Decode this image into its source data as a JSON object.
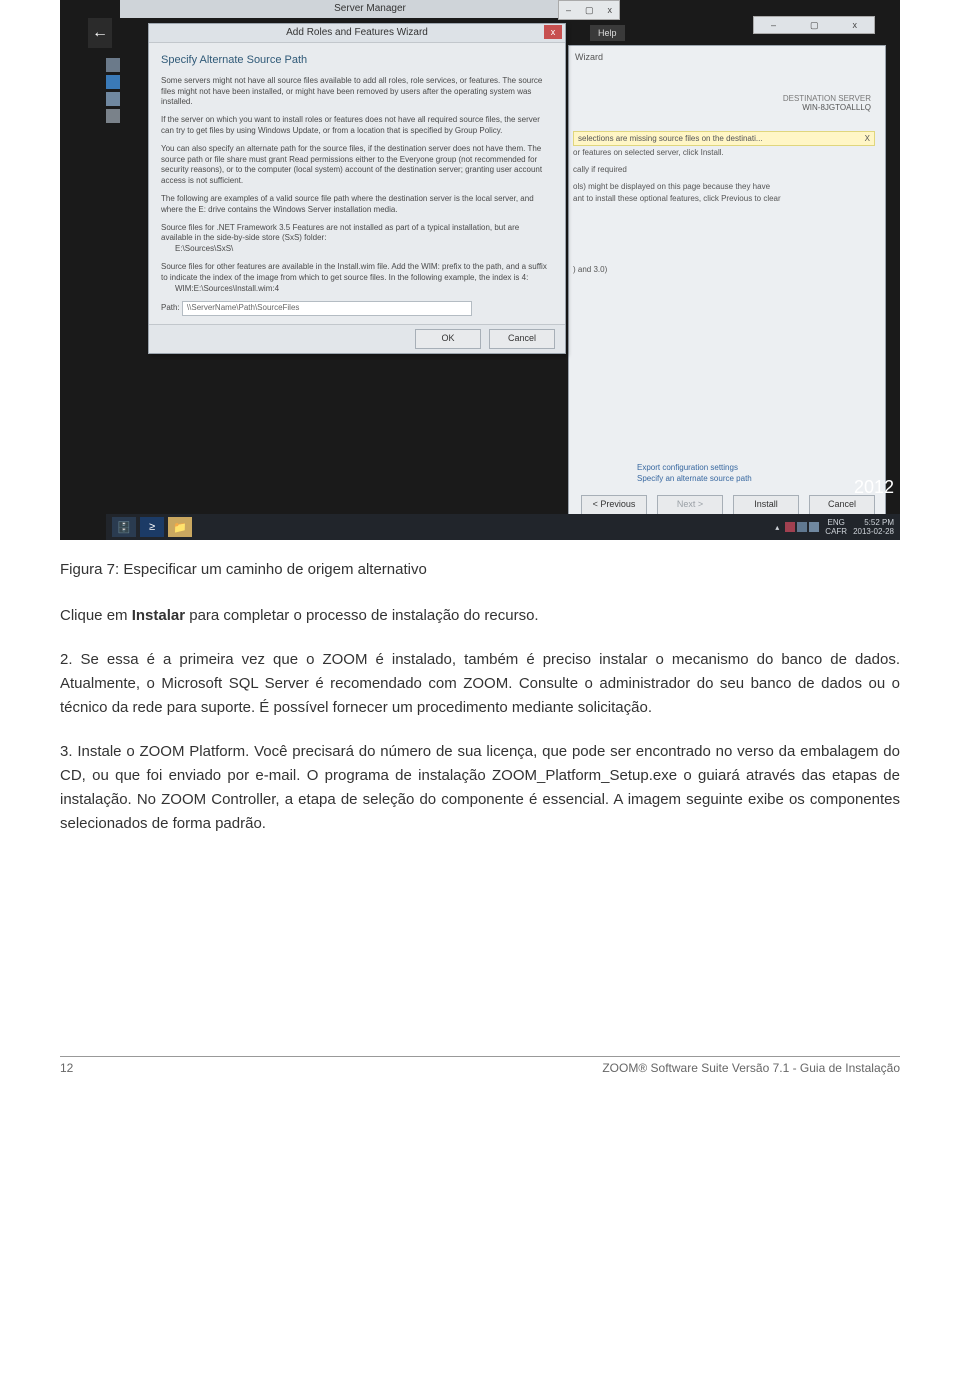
{
  "screenshot": {
    "server_manager_title": "Server Manager",
    "sm_controls": {
      "min": "–",
      "max": "▢",
      "close": "x"
    },
    "help_label": "Help",
    "dialog": {
      "title": "Add Roles and Features Wizard",
      "heading": "Specify Alternate Source Path",
      "para1": "Some servers might not have all source files available to add all roles, role services, or features. The source files might not have been installed, or might have been removed by users after the operating system was installed.",
      "para2": "If the server on which you want to install roles or features does not have all required source files, the server can try to get files by using Windows Update, or from a location that is specified by Group Policy.",
      "para3": "You can also specify an alternate path for the source files, if the destination server does not have them. The source path or file share must grant Read permissions either to the Everyone group (not recommended for security reasons), or to the computer (local system) account of the destination server; granting user account access is not sufficient.",
      "para4": "The following are examples of a valid source file path where the destination server is the local server, and where the E: drive contains the Windows Server installation media.",
      "para5": "Source files for .NET Framework 3.5 Features are not installed as part of a typical installation, but are available in the side-by-side store (SxS) folder:",
      "para5_path": "E:\\Sources\\SxS\\",
      "para6": "Source files for other features are available in the Install.wim file. Add the WIM: prefix to the path, and a suffix to indicate the index of the image from which to get source files. In the following example, the index is 4:",
      "para6_path": "WIM:E:\\Sources\\Install.wim:4",
      "path_label": "Path:",
      "path_value": "\\\\ServerName\\Path\\SourceFiles",
      "ok": "OK",
      "cancel": "Cancel"
    },
    "wizard": {
      "word": "Wizard",
      "dest_label": "DESTINATION SERVER",
      "dest_server": "WIN-8JGTOALLLQ",
      "banner": "selections are missing source files on the destinati...",
      "banner_x": "X",
      "line1": "or features on selected server, click Install.",
      "line2": "cally if required",
      "line3": "ols) might be displayed on this page because they have",
      "line4": "ant to install these optional features, click Previous to clear",
      "line5": ") and 3.0)",
      "link1": "Export configuration settings",
      "link2": "Specify an alternate source path",
      "prev": "< Previous",
      "next": "Next >",
      "install": "Install",
      "cancel": "Cancel"
    },
    "year": "2012",
    "taskbar": {
      "lang": "ENG",
      "cal": "CAFR",
      "time": "5:52 PM",
      "date": "2013-02-28"
    }
  },
  "doc": {
    "caption": "Figura 7: Especificar um caminho de origem alternativo",
    "p1_a": "Clique em ",
    "p1_b": "Instalar",
    "p1_c": " para completar o processo de instalação do recurso.",
    "p2": "2. Se essa é a primeira vez que o ZOOM é instalado, também é preciso instalar o mecanismo do banco de dados. Atualmente, o Microsoft SQL Server é recomendado com ZOOM. Consulte o administrador do seu banco de dados ou o técnico da rede para suporte. É possível fornecer um procedimento mediante solicitação.",
    "p3": "3. Instale o ZOOM Platform. Você precisará do número de sua licença, que pode ser encontrado no verso da embalagem do CD, ou que foi enviado por e-mail. O programa de instalação ZOOM_Platform_Setup.exe o guiará através das etapas de instalação. No ZOOM Controller, a etapa de seleção do componente é essencial. A imagem seguinte exibe os componentes selecionados de forma padrão.",
    "page_num": "12",
    "footer": "ZOOM® Software Suite Versão 7.1 - Guia de Instalação"
  }
}
